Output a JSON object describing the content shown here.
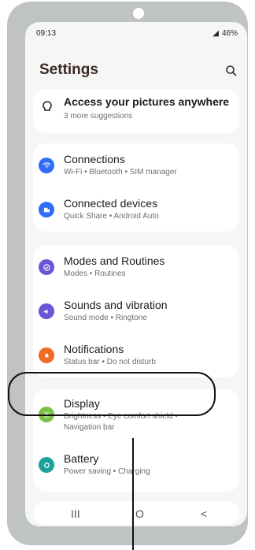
{
  "status": {
    "time": "09:13",
    "battery": "46%"
  },
  "header": {
    "title": "Settings"
  },
  "suggestion": {
    "title": "Access your pictures anywhere",
    "subtitle": "3 more suggestions"
  },
  "items": [
    {
      "title": "Connections",
      "subtitle": "Wi-Fi • Bluetooth • SIM manager",
      "color": "#2f6df6",
      "icon": "wifi-icon"
    },
    {
      "title": "Connected devices",
      "subtitle": "Quick Share • Android Auto",
      "color": "#2f6df6",
      "icon": "devices-icon"
    },
    {
      "title": "Modes and Routines",
      "subtitle": "Modes • Routines",
      "color": "#6b56d8",
      "icon": "check-circle-icon"
    },
    {
      "title": "Sounds and vibration",
      "subtitle": "Sound mode • Ringtone",
      "color": "#6b56d8",
      "icon": "speaker-icon"
    },
    {
      "title": "Notifications",
      "subtitle": "Status bar • Do not disturb",
      "color": "#f06b24",
      "icon": "bell-icon"
    },
    {
      "title": "Display",
      "subtitle_line1": "Brightness • Eye comfort shield •",
      "subtitle_line2": "Navigation bar",
      "color": "#7ac143",
      "icon": "sun-icon"
    },
    {
      "title": "Battery",
      "subtitle": "Power saving • Charging",
      "color": "#1aa39a",
      "icon": "battery-icon"
    }
  ],
  "nav": {
    "recents": "III",
    "home": "O",
    "back": "<"
  }
}
